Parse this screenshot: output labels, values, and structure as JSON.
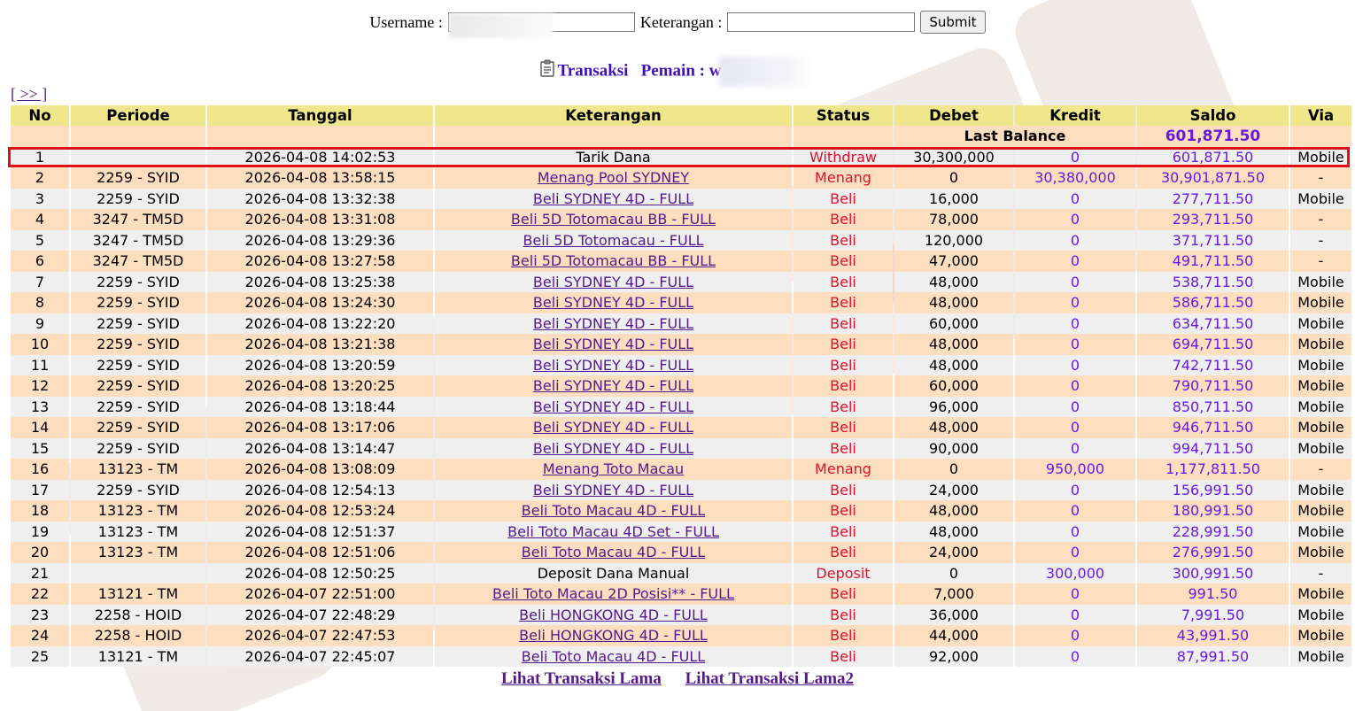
{
  "form": {
    "username_label": "Username :",
    "username_value": "",
    "keterangan_label": "Keterangan :",
    "keterangan_value": "",
    "submit_label": "Submit"
  },
  "heading": {
    "title": "Transaksi",
    "player_label": "Pemain : w",
    "icon": "clipboard-icon"
  },
  "nav": {
    "next_label": "[ >> ]"
  },
  "table": {
    "headers": [
      "No",
      "Periode",
      "Tanggal",
      "Keterangan",
      "Status",
      "Debet",
      "Kredit",
      "Saldo",
      "Via"
    ],
    "last_balance_label": "Last Balance",
    "last_balance_value": "601,871.50",
    "rows": [
      {
        "no": "1",
        "periode": "",
        "tanggal": "2026-04-08 14:02:53",
        "keterangan": "Tarik Dana",
        "link": false,
        "status": "Withdraw",
        "debet": "30,300,000",
        "kredit": "0",
        "saldo": "601,871.50",
        "via": "Mobile"
      },
      {
        "no": "2",
        "periode": "2259 - SYID",
        "tanggal": "2026-04-08 13:58:15",
        "keterangan": "Menang Pool SYDNEY",
        "link": true,
        "status": "Menang",
        "debet": "0",
        "kredit": "30,380,000",
        "saldo": "30,901,871.50",
        "via": "-"
      },
      {
        "no": "3",
        "periode": "2259 - SYID",
        "tanggal": "2026-04-08 13:32:38",
        "keterangan": "Beli SYDNEY 4D - FULL",
        "link": true,
        "status": "Beli",
        "debet": "16,000",
        "kredit": "0",
        "saldo": "277,711.50",
        "via": "Mobile"
      },
      {
        "no": "4",
        "periode": "3247 - TM5D",
        "tanggal": "2026-04-08 13:31:08",
        "keterangan": "Beli 5D Totomacau BB - FULL",
        "link": true,
        "status": "Beli",
        "debet": "78,000",
        "kredit": "0",
        "saldo": "293,711.50",
        "via": "-"
      },
      {
        "no": "5",
        "periode": "3247 - TM5D",
        "tanggal": "2026-04-08 13:29:36",
        "keterangan": "Beli 5D Totomacau - FULL",
        "link": true,
        "status": "Beli",
        "debet": "120,000",
        "kredit": "0",
        "saldo": "371,711.50",
        "via": "-"
      },
      {
        "no": "6",
        "periode": "3247 - TM5D",
        "tanggal": "2026-04-08 13:27:58",
        "keterangan": "Beli 5D Totomacau BB - FULL",
        "link": true,
        "status": "Beli",
        "debet": "47,000",
        "kredit": "0",
        "saldo": "491,711.50",
        "via": "-"
      },
      {
        "no": "7",
        "periode": "2259 - SYID",
        "tanggal": "2026-04-08 13:25:38",
        "keterangan": "Beli SYDNEY 4D - FULL",
        "link": true,
        "status": "Beli",
        "debet": "48,000",
        "kredit": "0",
        "saldo": "538,711.50",
        "via": "Mobile"
      },
      {
        "no": "8",
        "periode": "2259 - SYID",
        "tanggal": "2026-04-08 13:24:30",
        "keterangan": "Beli SYDNEY 4D - FULL",
        "link": true,
        "status": "Beli",
        "debet": "48,000",
        "kredit": "0",
        "saldo": "586,711.50",
        "via": "Mobile"
      },
      {
        "no": "9",
        "periode": "2259 - SYID",
        "tanggal": "2026-04-08 13:22:20",
        "keterangan": "Beli SYDNEY 4D - FULL",
        "link": true,
        "status": "Beli",
        "debet": "60,000",
        "kredit": "0",
        "saldo": "634,711.50",
        "via": "Mobile"
      },
      {
        "no": "10",
        "periode": "2259 - SYID",
        "tanggal": "2026-04-08 13:21:38",
        "keterangan": "Beli SYDNEY 4D - FULL",
        "link": true,
        "status": "Beli",
        "debet": "48,000",
        "kredit": "0",
        "saldo": "694,711.50",
        "via": "Mobile"
      },
      {
        "no": "11",
        "periode": "2259 - SYID",
        "tanggal": "2026-04-08 13:20:59",
        "keterangan": "Beli SYDNEY 4D - FULL",
        "link": true,
        "status": "Beli",
        "debet": "48,000",
        "kredit": "0",
        "saldo": "742,711.50",
        "via": "Mobile"
      },
      {
        "no": "12",
        "periode": "2259 - SYID",
        "tanggal": "2026-04-08 13:20:25",
        "keterangan": "Beli SYDNEY 4D - FULL",
        "link": true,
        "status": "Beli",
        "debet": "60,000",
        "kredit": "0",
        "saldo": "790,711.50",
        "via": "Mobile"
      },
      {
        "no": "13",
        "periode": "2259 - SYID",
        "tanggal": "2026-04-08 13:18:44",
        "keterangan": "Beli SYDNEY 4D - FULL",
        "link": true,
        "status": "Beli",
        "debet": "96,000",
        "kredit": "0",
        "saldo": "850,711.50",
        "via": "Mobile"
      },
      {
        "no": "14",
        "periode": "2259 - SYID",
        "tanggal": "2026-04-08 13:17:06",
        "keterangan": "Beli SYDNEY 4D - FULL",
        "link": true,
        "status": "Beli",
        "debet": "48,000",
        "kredit": "0",
        "saldo": "946,711.50",
        "via": "Mobile"
      },
      {
        "no": "15",
        "periode": "2259 - SYID",
        "tanggal": "2026-04-08 13:14:47",
        "keterangan": "Beli SYDNEY 4D - FULL",
        "link": true,
        "status": "Beli",
        "debet": "90,000",
        "kredit": "0",
        "saldo": "994,711.50",
        "via": "Mobile"
      },
      {
        "no": "16",
        "periode": "13123 - TM",
        "tanggal": "2026-04-08 13:08:09",
        "keterangan": "Menang Toto Macau",
        "link": true,
        "status": "Menang",
        "debet": "0",
        "kredit": "950,000",
        "saldo": "1,177,811.50",
        "via": "-"
      },
      {
        "no": "17",
        "periode": "2259 - SYID",
        "tanggal": "2026-04-08 12:54:13",
        "keterangan": "Beli SYDNEY 4D - FULL",
        "link": true,
        "status": "Beli",
        "debet": "24,000",
        "kredit": "0",
        "saldo": "156,991.50",
        "via": "Mobile"
      },
      {
        "no": "18",
        "periode": "13123 - TM",
        "tanggal": "2026-04-08 12:53:24",
        "keterangan": "Beli Toto Macau 4D - FULL",
        "link": true,
        "status": "Beli",
        "debet": "48,000",
        "kredit": "0",
        "saldo": "180,991.50",
        "via": "Mobile"
      },
      {
        "no": "19",
        "periode": "13123 - TM",
        "tanggal": "2026-04-08 12:51:37",
        "keterangan": "Beli Toto Macau 4D Set - FULL",
        "link": true,
        "status": "Beli",
        "debet": "48,000",
        "kredit": "0",
        "saldo": "228,991.50",
        "via": "Mobile"
      },
      {
        "no": "20",
        "periode": "13123 - TM",
        "tanggal": "2026-04-08 12:51:06",
        "keterangan": "Beli Toto Macau 4D - FULL",
        "link": true,
        "status": "Beli",
        "debet": "24,000",
        "kredit": "0",
        "saldo": "276,991.50",
        "via": "Mobile"
      },
      {
        "no": "21",
        "periode": "",
        "tanggal": "2026-04-08 12:50:25",
        "keterangan": "Deposit Dana Manual",
        "link": false,
        "status": "Deposit",
        "debet": "0",
        "kredit": "300,000",
        "saldo": "300,991.50",
        "via": "-"
      },
      {
        "no": "22",
        "periode": "13121 - TM",
        "tanggal": "2026-04-07 22:51:00",
        "keterangan": "Beli Toto Macau 2D Posisi** - FULL",
        "link": true,
        "status": "Beli",
        "debet": "7,000",
        "kredit": "0",
        "saldo": "991.50",
        "via": "Mobile"
      },
      {
        "no": "23",
        "periode": "2258 - HOID",
        "tanggal": "2026-04-07 22:48:29",
        "keterangan": "Beli HONGKONG 4D - FULL",
        "link": true,
        "status": "Beli",
        "debet": "36,000",
        "kredit": "0",
        "saldo": "7,991.50",
        "via": "Mobile"
      },
      {
        "no": "24",
        "periode": "2258 - HOID",
        "tanggal": "2026-04-07 22:47:53",
        "keterangan": "Beli HONGKONG 4D - FULL",
        "link": true,
        "status": "Beli",
        "debet": "44,000",
        "kredit": "0",
        "saldo": "43,991.50",
        "via": "Mobile"
      },
      {
        "no": "25",
        "periode": "13121 - TM",
        "tanggal": "2026-04-07 22:45:07",
        "keterangan": "Beli Toto Macau 4D - FULL",
        "link": true,
        "status": "Beli",
        "debet": "92,000",
        "kredit": "0",
        "saldo": "87,991.50",
        "via": "Mobile"
      }
    ]
  },
  "footer": {
    "link1": "Lihat Transaksi Lama",
    "link2": "Lihat Transaksi Lama2"
  },
  "colors": {
    "header_bg": "#f0e68c",
    "row_even": "#fddebf",
    "row_odd": "#efefef",
    "status": "#e0102a",
    "kredit_saldo": "#6a1ae0",
    "link": "#551a8b",
    "highlight": "#e0101a"
  }
}
